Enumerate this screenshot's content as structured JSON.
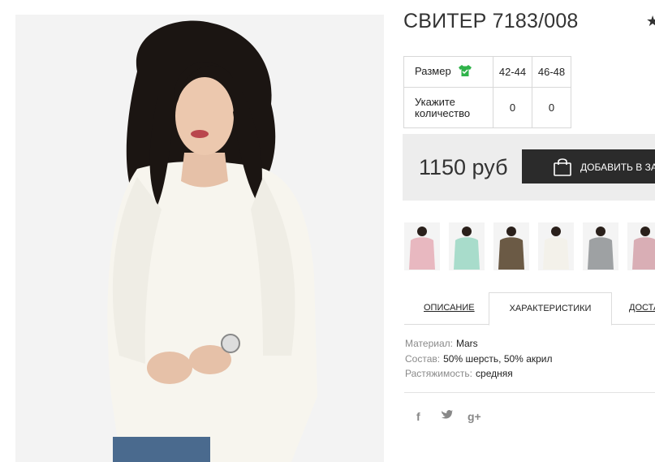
{
  "product": {
    "title": "СВИТЕР 7183/008",
    "favorite_icon": "star-icon"
  },
  "size_table": {
    "size_label": "Размер",
    "size_icon": "tshirt-icon",
    "sizes": [
      "42-44",
      "46-48"
    ],
    "qty_label": "Укажите количество",
    "qty_values": [
      "0",
      "0"
    ]
  },
  "purchase": {
    "price": "1150 руб",
    "add_to_cart_label": "ДОБАВИТЬ В ЗАКАЗ",
    "cart_icon": "shopping-bag-icon"
  },
  "thumbnails": [
    {
      "color": "#e8b8c0"
    },
    {
      "color": "#a8dccb"
    },
    {
      "color": "#6b5a45"
    },
    {
      "color": "#f3f1ea"
    },
    {
      "color": "#9ea1a3"
    },
    {
      "color": "#d9aeb5"
    }
  ],
  "tabs": [
    {
      "label": "ОПИСАНИЕ",
      "active": false
    },
    {
      "label": "ХАРАКТЕРИСТИКИ",
      "active": true
    },
    {
      "label": "ДОСТАВКА",
      "active": false
    }
  ],
  "specs": [
    {
      "key": "Материал:",
      "value": "Mars"
    },
    {
      "key": "Состав:",
      "value": "50% шерсть, 50% акрил"
    },
    {
      "key": "Растяжимость:",
      "value": "средняя"
    }
  ],
  "social": [
    {
      "icon": "facebook-icon",
      "glyph": "f"
    },
    {
      "icon": "twitter-icon",
      "glyph": "t"
    },
    {
      "icon": "google-plus-icon",
      "glyph": "g+"
    }
  ],
  "colors": {
    "cart_button_bg": "#2b2b2b",
    "price_panel_bg": "#ededed",
    "size_icon_green": "#2fb34a"
  }
}
